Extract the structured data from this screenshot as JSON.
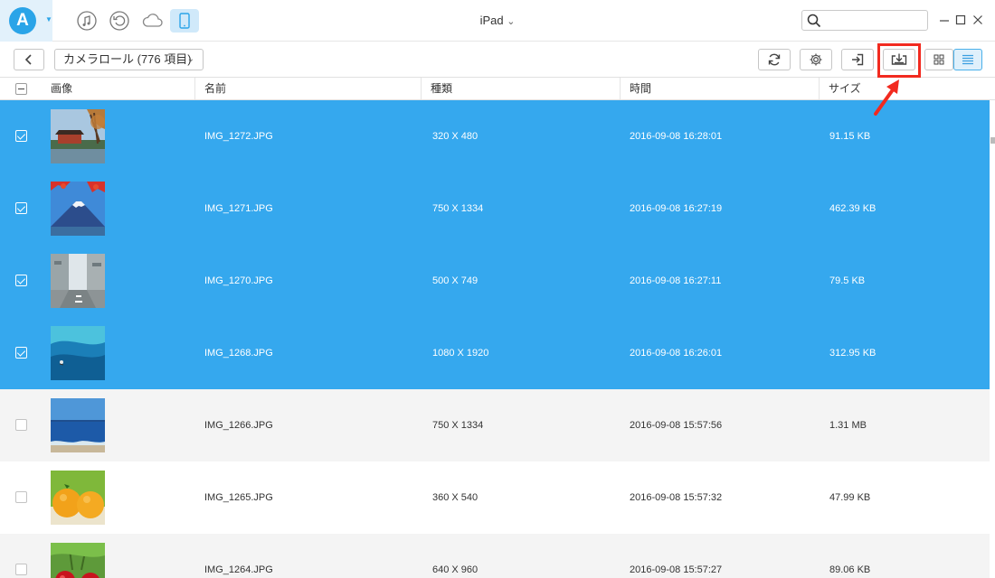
{
  "titlebar": {
    "app_logo_letter": "A",
    "device_name": "iPad",
    "device_caret": "⌄",
    "search_placeholder": "",
    "search_value": ""
  },
  "toolbar": {
    "album_label": "カメラロール (776 項目)",
    "album_caret": "⌄"
  },
  "table": {
    "columns": [
      "画像",
      "名前",
      "種類",
      "時間",
      "サイズ"
    ],
    "rows": [
      {
        "name": "IMG_1272.JPG",
        "type": "320 X 480",
        "time": "2016-09-08 16:28:01",
        "size": "91.15 KB",
        "selected": true,
        "thumb": "temple"
      },
      {
        "name": "IMG_1271.JPG",
        "type": "750 X 1334",
        "time": "2016-09-08 16:27:19",
        "size": "462.39 KB",
        "selected": true,
        "thumb": "mountain"
      },
      {
        "name": "IMG_1270.JPG",
        "type": "500 X 749",
        "time": "2016-09-08 16:27:11",
        "size": "79.5 KB",
        "selected": true,
        "thumb": "street"
      },
      {
        "name": "IMG_1268.JPG",
        "type": "1080 X 1920",
        "time": "2016-09-08 16:26:01",
        "size": "312.95 KB",
        "selected": true,
        "thumb": "water"
      },
      {
        "name": "IMG_1266.JPG",
        "type": "750 X 1334",
        "time": "2016-09-08 15:57:56",
        "size": "1.31 MB",
        "selected": false,
        "thumb": "sea"
      },
      {
        "name": "IMG_1265.JPG",
        "type": "360 X 540",
        "time": "2016-09-08 15:57:32",
        "size": "47.99 KB",
        "selected": false,
        "thumb": "oranges"
      },
      {
        "name": "IMG_1264.JPG",
        "type": "640 X 960",
        "time": "2016-09-08 15:57:27",
        "size": "89.06 KB",
        "selected": false,
        "thumb": "cherries"
      }
    ]
  },
  "colors": {
    "selection": "#35a8ee",
    "highlight_border": "#f22a1f",
    "accent": "#2aa4e8"
  }
}
